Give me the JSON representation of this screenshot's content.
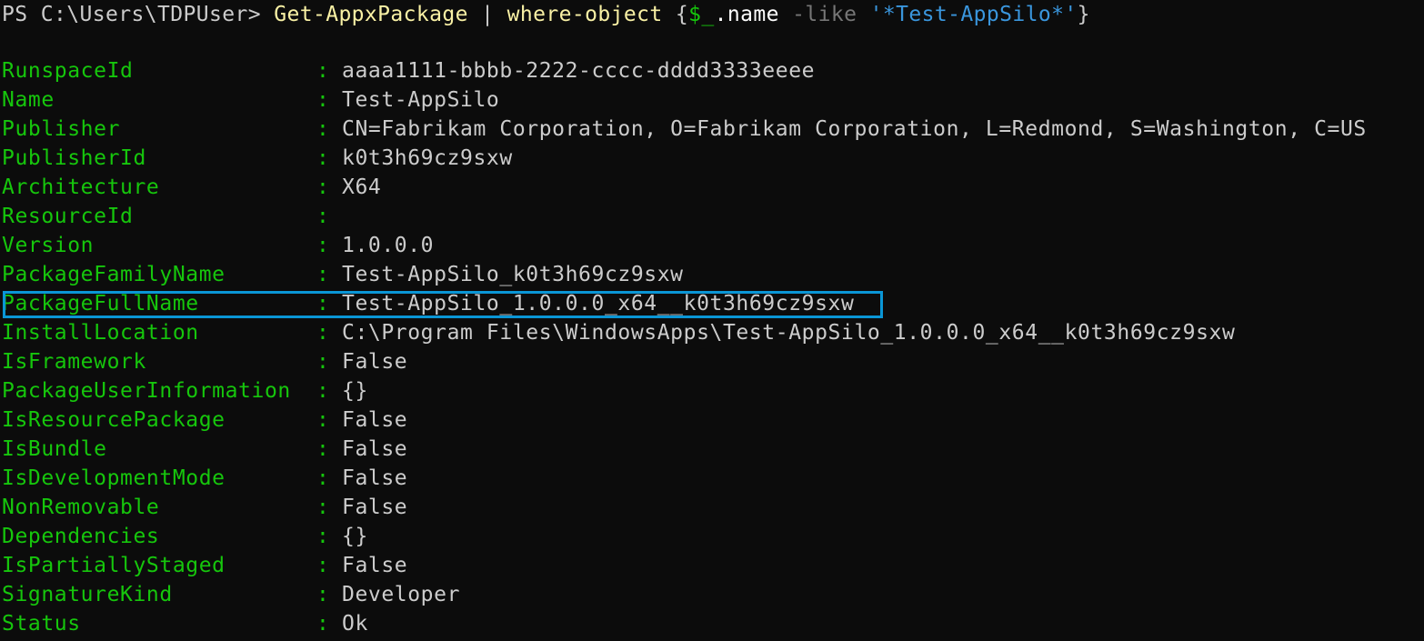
{
  "terminal": {
    "prompt": "PS C:\\Users\\TDPUser> ",
    "command": {
      "cmdlet": "Get-AppxPackage",
      "pipe": " | ",
      "filter_cmdlet": "where-object",
      "open_brace": " {",
      "variable": "$_",
      "property": ".name",
      "operator": " -like ",
      "pattern": "'*Test-AppSilo*'",
      "close_brace": "}"
    }
  },
  "separator": ":",
  "properties": [
    {
      "key": "RunspaceId",
      "value": "aaaa1111-bbbb-2222-cccc-dddd3333eeee"
    },
    {
      "key": "Name",
      "value": "Test-AppSilo"
    },
    {
      "key": "Publisher",
      "value": "CN=Fabrikam Corporation, O=Fabrikam Corporation, L=Redmond, S=Washington, C=US"
    },
    {
      "key": "PublisherId",
      "value": "k0t3h69cz9sxw"
    },
    {
      "key": "Architecture",
      "value": "X64"
    },
    {
      "key": "ResourceId",
      "value": ""
    },
    {
      "key": "Version",
      "value": "1.0.0.0"
    },
    {
      "key": "PackageFamilyName",
      "value": "Test-AppSilo_k0t3h69cz9sxw"
    },
    {
      "key": "PackageFullName",
      "value": "Test-AppSilo_1.0.0.0_x64__k0t3h69cz9sxw",
      "highlighted": true
    },
    {
      "key": "InstallLocation",
      "value": "C:\\Program Files\\WindowsApps\\Test-AppSilo_1.0.0.0_x64__k0t3h69cz9sxw"
    },
    {
      "key": "IsFramework",
      "value": "False"
    },
    {
      "key": "PackageUserInformation",
      "value": "{}"
    },
    {
      "key": "IsResourcePackage",
      "value": "False"
    },
    {
      "key": "IsBundle",
      "value": "False"
    },
    {
      "key": "IsDevelopmentMode",
      "value": "False"
    },
    {
      "key": "NonRemovable",
      "value": "False"
    },
    {
      "key": "Dependencies",
      "value": "{}"
    },
    {
      "key": "IsPartiallyStaged",
      "value": "False"
    },
    {
      "key": "SignatureKind",
      "value": "Developer"
    },
    {
      "key": "Status",
      "value": "Ok"
    }
  ],
  "colors": {
    "background": "#0c0c0c",
    "property_key": "#16c60c",
    "property_value": "#cccccc",
    "command": "#f9f1a5",
    "string_literal": "#3a96dd",
    "operator": "#767676",
    "highlight_border": "#0a96d6"
  }
}
